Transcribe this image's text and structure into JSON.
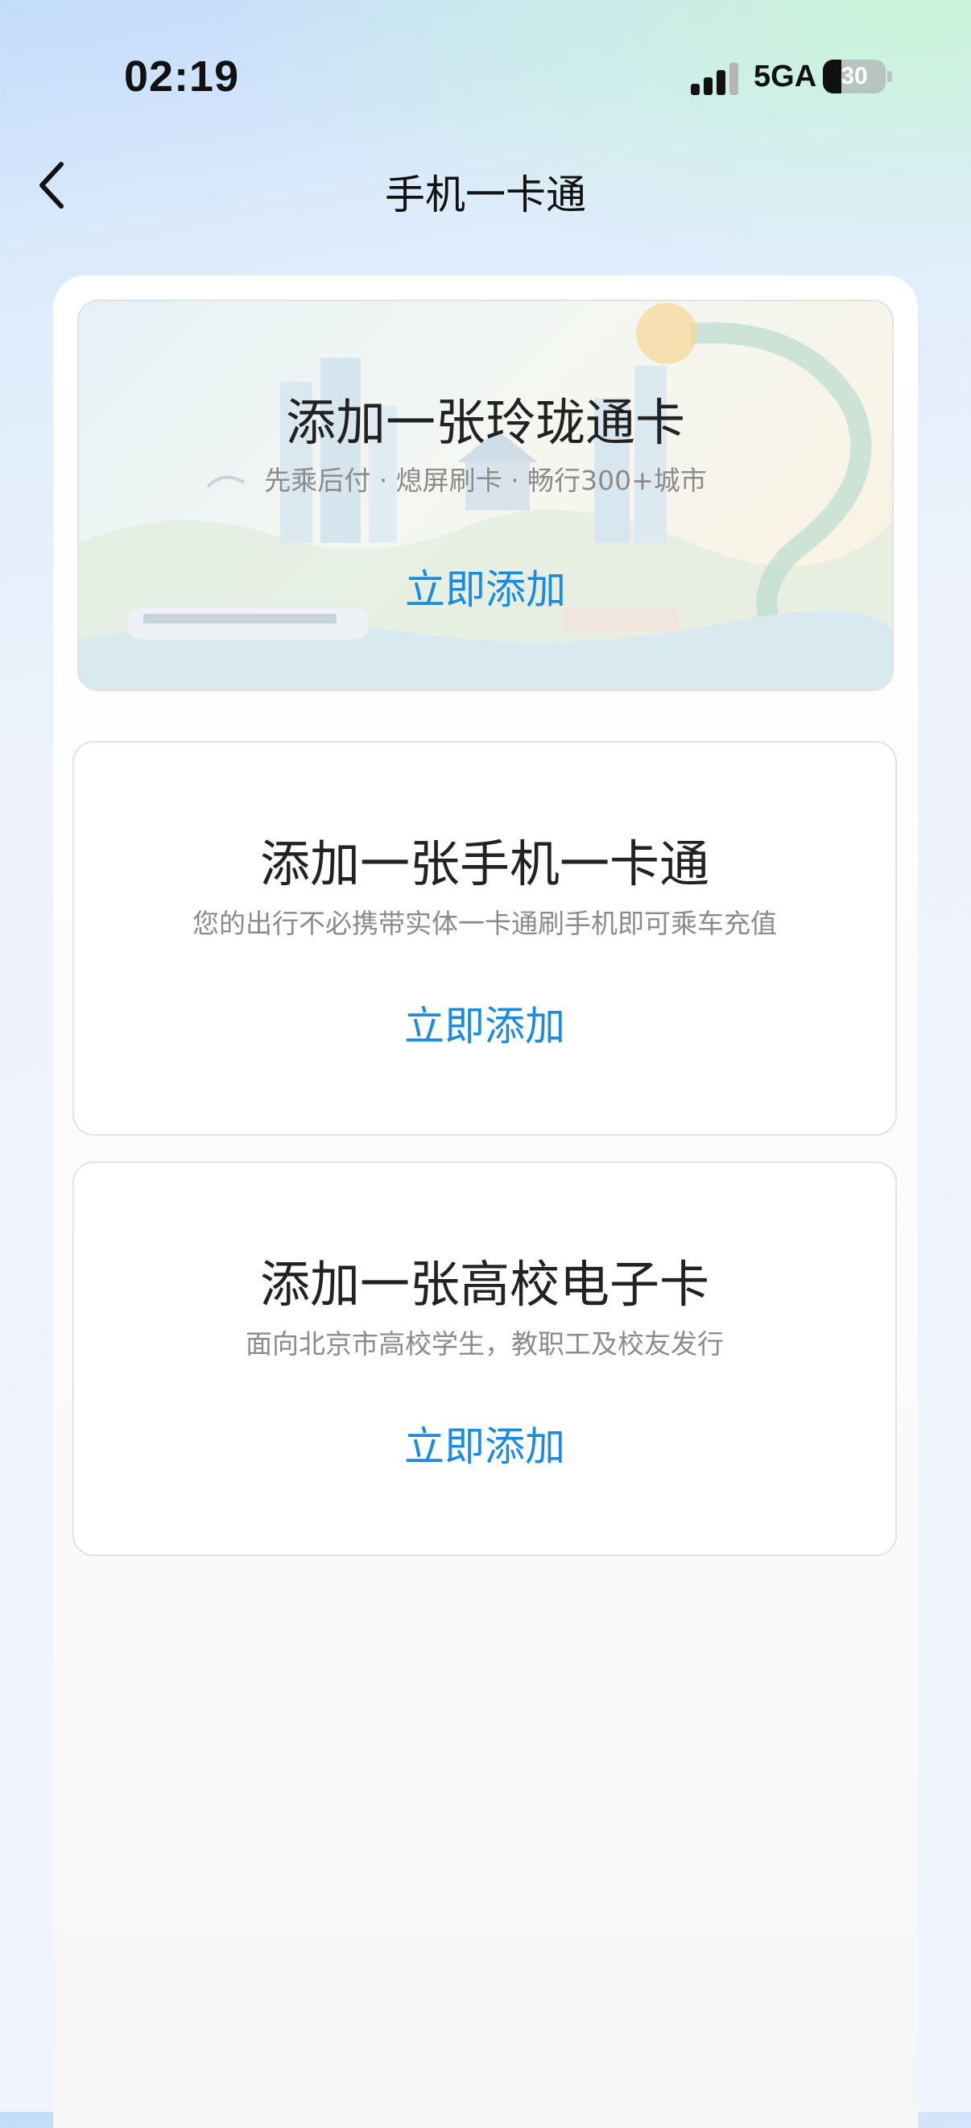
{
  "status_bar": {
    "time": "02:19",
    "network": "5GA",
    "battery": "30",
    "battery_level": 0.3,
    "signal_bars": 3
  },
  "nav": {
    "title": "手机一卡通",
    "back_icon": "chevron-left-icon"
  },
  "cards": [
    {
      "title": "添加一张玲珑通卡",
      "subtitle": "先乘后付 · 熄屏刷卡 · 畅行300+城市",
      "action": "立即添加"
    },
    {
      "title": "添加一张手机一卡通",
      "subtitle": "您的出行不必携带实体一卡通刷手机即可乘车充值",
      "action": "立即添加"
    },
    {
      "title": "添加一张高校电子卡",
      "subtitle": "面向北京市高校学生，教职工及校友发行",
      "action": "立即添加"
    }
  ],
  "colors": {
    "accent": "#1a8be0",
    "title": "#222222",
    "subtitle": "#8b8b8b"
  }
}
